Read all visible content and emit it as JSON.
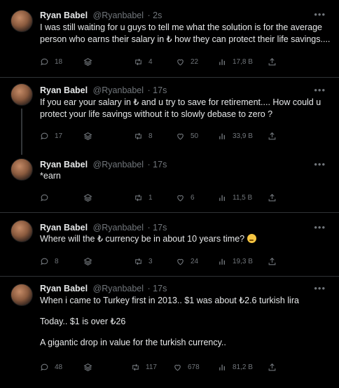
{
  "tweets": [
    {
      "name": "Ryan Babel",
      "handle": "@Ryanbabel",
      "time": "· 2s",
      "lines": [
        "I was still waiting for u guys to tell me what the solution is for the average",
        "person who earns their salary in ₺ how they can protect their life savings...."
      ],
      "replies": "18",
      "retweets": "4",
      "likes": "22",
      "views": "17,8 B"
    },
    {
      "name": "Ryan Babel",
      "handle": "@Ryanbabel",
      "time": "· 17s",
      "lines": [
        "If you ear your salary in ₺ and u try to save for retirement.... How could u",
        "protect your life savings without it to slowly debase to zero ?"
      ],
      "replies": "17",
      "retweets": "8",
      "likes": "50",
      "views": "33,9 B"
    },
    {
      "name": "Ryan Babel",
      "handle": "@Ryanbabel",
      "time": "· 17s",
      "lines": [
        "*earn"
      ],
      "replies": "",
      "retweets": "1",
      "likes": "6",
      "views": "11,5 B"
    },
    {
      "name": "Ryan Babel",
      "handle": "@Ryanbabel",
      "time": "· 17s",
      "lines": [
        "Where will the ₺ currency be in about 10 years time?"
      ],
      "emoji": "thinking-face-emoji",
      "replies": "8",
      "retweets": "3",
      "likes": "24",
      "views": "19,3 B"
    },
    {
      "name": "Ryan Babel",
      "handle": "@Ryanbabel",
      "time": "· 17s",
      "lines": [
        "When i came to Turkey first in 2013.. $1 was about ₺2.6 turkish lira",
        "",
        "Today.. $1 is over ₺26",
        "",
        "A gigantic drop in value for the turkish currency.."
      ],
      "replies": "48",
      "retweets": "117",
      "likes": "678",
      "views": "81,2 B"
    }
  ],
  "icons": {
    "reply": "reply-icon",
    "stack": "stack-icon",
    "retweet": "retweet-icon",
    "like": "heart-icon",
    "views": "views-icon",
    "share": "share-icon",
    "more": "more-icon"
  }
}
